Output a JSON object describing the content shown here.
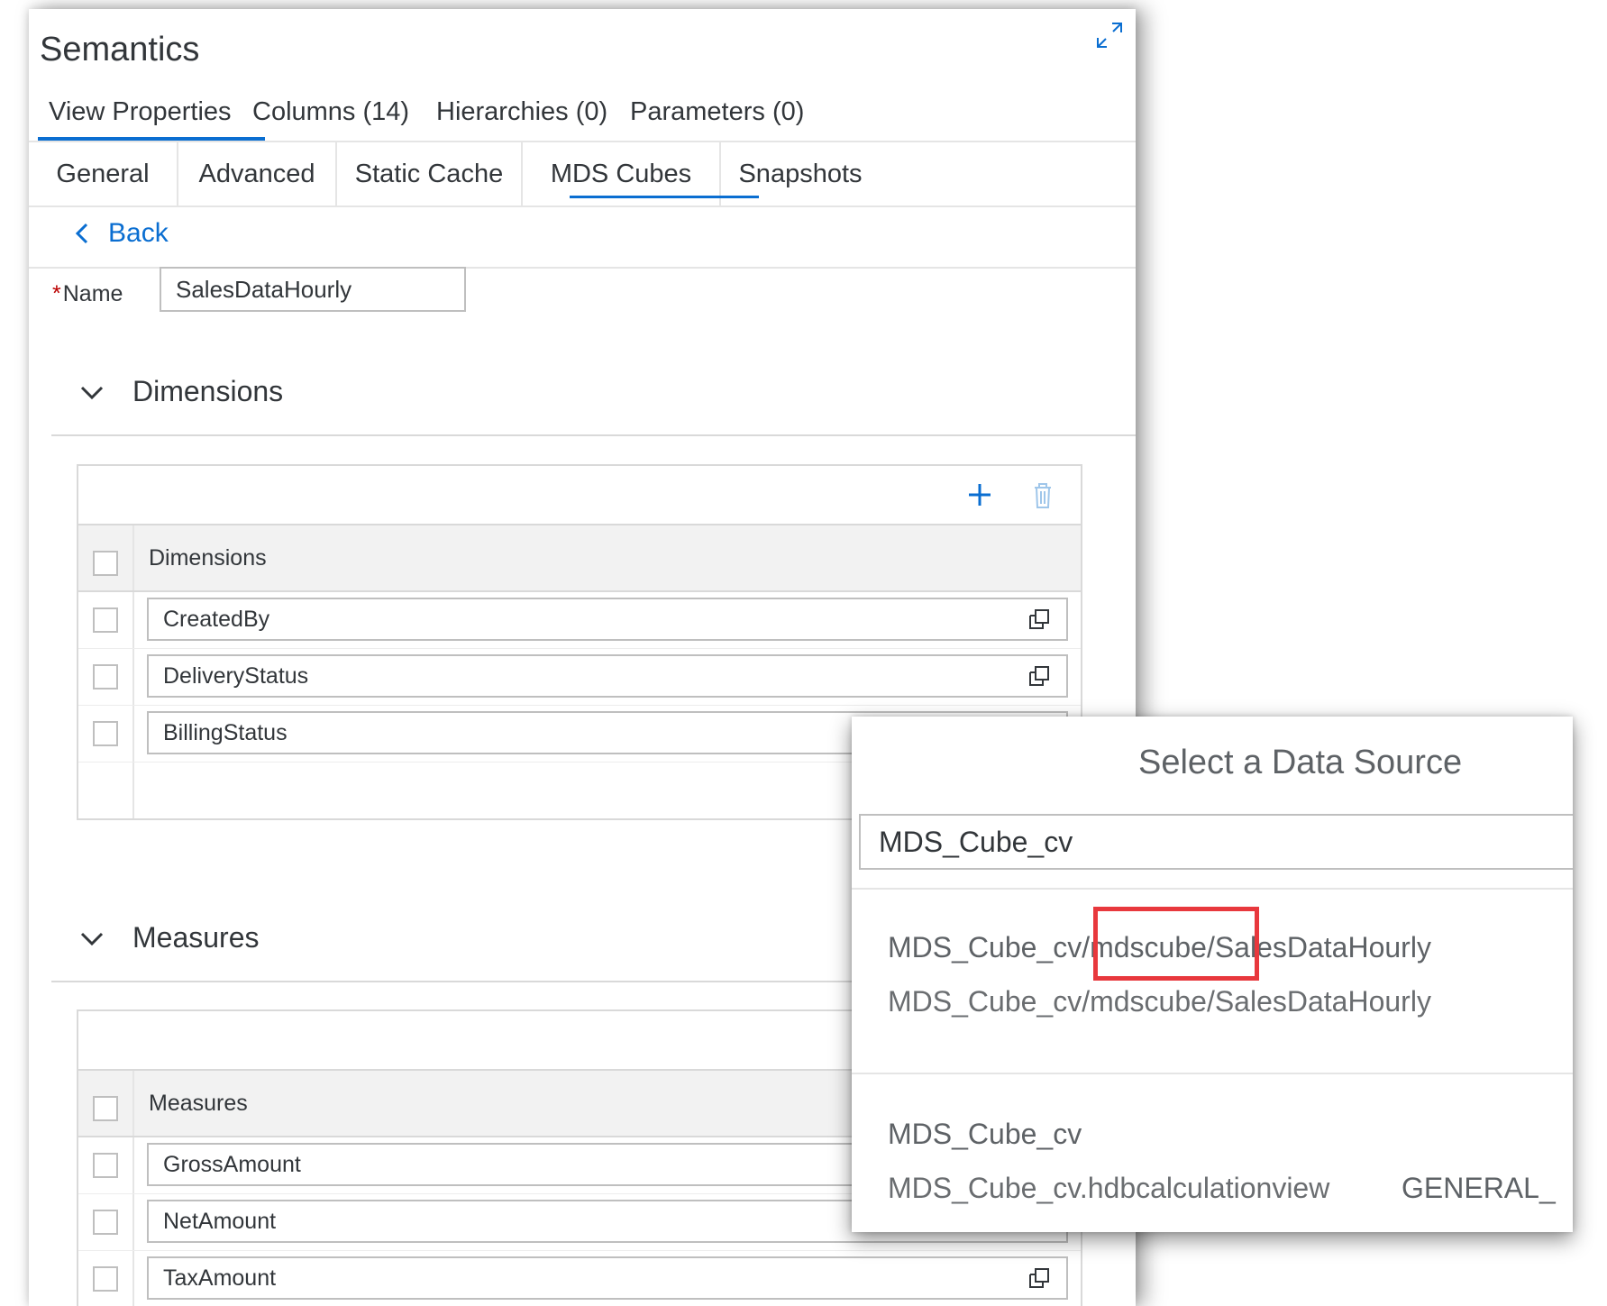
{
  "panel": {
    "title": "Semantics",
    "top_tabs": [
      {
        "label": "View Properties",
        "active": true
      },
      {
        "label": "Columns (14)"
      },
      {
        "label": "Hierarchies (0)"
      },
      {
        "label": "Parameters (0)"
      }
    ],
    "sub_tabs": [
      {
        "label": "General"
      },
      {
        "label": "Advanced"
      },
      {
        "label": "Static Cache"
      },
      {
        "label": "MDS Cubes",
        "active": true
      },
      {
        "label": "Snapshots"
      }
    ],
    "back_label": "Back",
    "name_required_mark": "*",
    "name_label": "Name",
    "name_value": "SalesDataHourly",
    "dimensions": {
      "section_title": "Dimensions",
      "column_header": "Dimensions",
      "rows": [
        "CreatedBy",
        "DeliveryStatus",
        "BillingStatus"
      ]
    },
    "measures": {
      "section_title": "Measures",
      "column_header": "Measures",
      "rows": [
        "GrossAmount",
        "NetAmount",
        "TaxAmount"
      ]
    }
  },
  "popover": {
    "title": "Select a Data Source",
    "search_value": "MDS_Cube_cv",
    "results": [
      {
        "primary": "MDS_Cube_cv/mdscube/SalesDataHourly",
        "secondary": "MDS_Cube_cv/mdscube/SalesDataHourly"
      },
      {
        "primary": "MDS_Cube_cv",
        "secondary": "MDS_Cube_cv.hdbcalculationview",
        "tag": "GENERAL_"
      }
    ]
  },
  "colors": {
    "accent": "#0a6ed1",
    "required": "#bb0000",
    "highlight": "#e8383d"
  }
}
